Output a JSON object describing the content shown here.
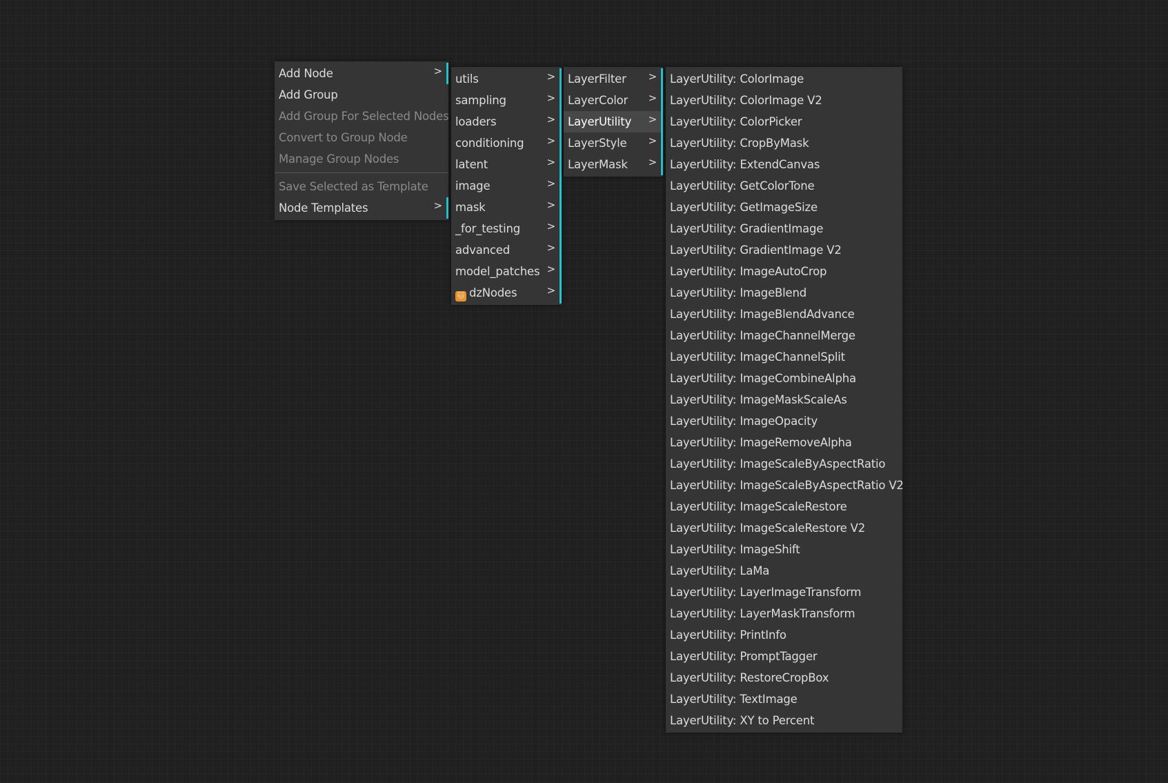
{
  "accent_color": "#1fc8d4",
  "menu1": {
    "items": [
      {
        "label": "Add Node",
        "submenu": true,
        "disabled": false
      },
      {
        "label": "Add Group",
        "submenu": false,
        "disabled": false
      },
      {
        "label": "Add Group For Selected Nodes",
        "submenu": false,
        "disabled": true
      },
      {
        "label": "Convert to Group Node",
        "submenu": false,
        "disabled": true
      },
      {
        "label": "Manage Group Nodes",
        "submenu": false,
        "disabled": true
      },
      {
        "separator": true
      },
      {
        "label": "Save Selected as Template",
        "submenu": false,
        "disabled": true
      },
      {
        "label": "Node Templates",
        "submenu": true,
        "disabled": false
      }
    ]
  },
  "menu2": {
    "items": [
      {
        "label": "utils"
      },
      {
        "label": "sampling"
      },
      {
        "label": "loaders"
      },
      {
        "label": "conditioning"
      },
      {
        "label": "latent"
      },
      {
        "label": "image"
      },
      {
        "label": "mask"
      },
      {
        "label": "_for_testing"
      },
      {
        "label": "advanced"
      },
      {
        "label": "model_patches"
      },
      {
        "label": "dzNodes",
        "icon": "cat-icon"
      }
    ]
  },
  "menu3": {
    "active": "LayerUtility",
    "items": [
      {
        "label": "LayerFilter"
      },
      {
        "label": "LayerColor"
      },
      {
        "label": "LayerUtility"
      },
      {
        "label": "LayerStyle"
      },
      {
        "label": "LayerMask"
      }
    ]
  },
  "menu4": {
    "items": [
      "LayerUtility: ColorImage",
      "LayerUtility: ColorImage V2",
      "LayerUtility: ColorPicker",
      "LayerUtility: CropByMask",
      "LayerUtility: ExtendCanvas",
      "LayerUtility: GetColorTone",
      "LayerUtility: GetImageSize",
      "LayerUtility: GradientImage",
      "LayerUtility: GradientImage V2",
      "LayerUtility: ImageAutoCrop",
      "LayerUtility: ImageBlend",
      "LayerUtility: ImageBlendAdvance",
      "LayerUtility: ImageChannelMerge",
      "LayerUtility: ImageChannelSplit",
      "LayerUtility: ImageCombineAlpha",
      "LayerUtility: ImageMaskScaleAs",
      "LayerUtility: ImageOpacity",
      "LayerUtility: ImageRemoveAlpha",
      "LayerUtility: ImageScaleByAspectRatio",
      "LayerUtility: ImageScaleByAspectRatio V2",
      "LayerUtility: ImageScaleRestore",
      "LayerUtility: ImageScaleRestore V2",
      "LayerUtility: ImageShift",
      "LayerUtility: LaMa",
      "LayerUtility: LayerImageTransform",
      "LayerUtility: LayerMaskTransform",
      "LayerUtility: PrintInfo",
      "LayerUtility: PromptTagger",
      "LayerUtility: RestoreCropBox",
      "LayerUtility: TextImage",
      "LayerUtility: XY to Percent"
    ]
  },
  "arrow_glyph": ">"
}
